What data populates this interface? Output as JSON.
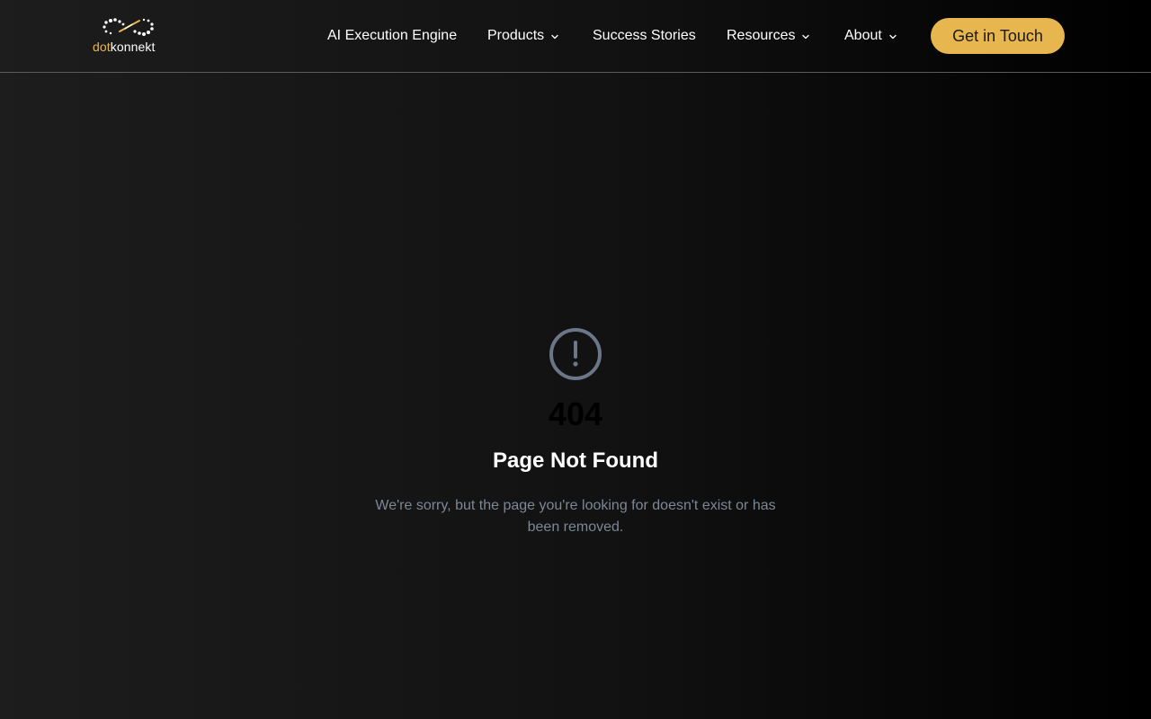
{
  "brand": {
    "logo_prefix": "dot",
    "logo_suffix": "konnekt",
    "accent_color": "#e8b64e"
  },
  "nav": {
    "items": [
      {
        "label": "AI Execution Engine",
        "has_dropdown": false
      },
      {
        "label": "Products",
        "has_dropdown": true
      },
      {
        "label": "Success Stories",
        "has_dropdown": false
      },
      {
        "label": "Resources",
        "has_dropdown": true
      },
      {
        "label": "About",
        "has_dropdown": true
      }
    ],
    "cta_label": "Get in Touch"
  },
  "error": {
    "icon": "alert-circle-icon",
    "code": "404",
    "title": "Page Not Found",
    "message": "We're sorry, but the page you're looking for doesn't exist or has been removed."
  }
}
